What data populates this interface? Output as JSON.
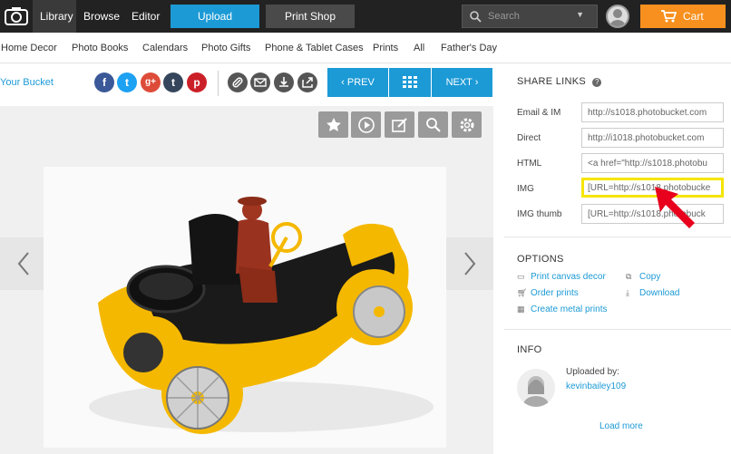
{
  "nav": {
    "library": "Library",
    "browse": "Browse",
    "editor": "Editor",
    "upload": "Upload",
    "print_shop": "Print Shop",
    "search_placeholder": "Search",
    "cart": "Cart"
  },
  "categories": [
    "Home Decor",
    "Photo Books",
    "Calendars",
    "Photo Gifts",
    "Phone & Tablet Cases",
    "Prints",
    "All",
    "Father's Day"
  ],
  "bucket_link": "Your Bucket",
  "social": {
    "facebook": "f",
    "twitter": "t",
    "googleplus": "g+",
    "tumblr": "t",
    "pinterest": "p"
  },
  "pager": {
    "prev": "PREV",
    "next": "NEXT"
  },
  "share": {
    "title": "SHARE LINKS",
    "rows": [
      {
        "label": "Email & IM",
        "value": "http://s1018.photobucket.com"
      },
      {
        "label": "Direct",
        "value": "http://i1018.photobucket.com"
      },
      {
        "label": "HTML",
        "value": "<a href=\"http://s1018.photobu"
      },
      {
        "label": "IMG",
        "value": "[URL=http://s1018.photobucke"
      },
      {
        "label": "IMG thumb",
        "value": "[URL=http://s1018.photobuck"
      }
    ]
  },
  "options": {
    "title": "OPTIONS",
    "print_canvas": "Print canvas decor",
    "copy": "Copy",
    "order_prints": "Order prints",
    "download": "Download",
    "metal_prints": "Create metal prints"
  },
  "info": {
    "title": "INFO",
    "uploaded_by": "Uploaded by:",
    "user": "kevinbailey109",
    "load_more": "Load more"
  },
  "colors": {
    "accent": "#1c9ad6",
    "cart": "#f7901e",
    "highlight": "#f6e500",
    "arrow": "#e8001c"
  }
}
